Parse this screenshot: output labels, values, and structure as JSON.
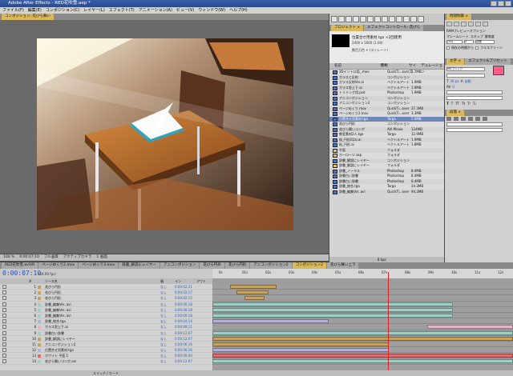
{
  "window": {
    "title": "Adobe After Effects - RED花吹雪.aep *"
  },
  "menu": [
    "ファイル(F)",
    "編集(E)",
    "コンポジション(C)",
    "レイヤー(L)",
    "エフェクト(T)",
    "アニメーション(A)",
    "ビュー(V)",
    "ウィンドウ(W)",
    "ヘルプ(H)"
  ],
  "comp_tabs": [
    "コンポジション: 花びら舞い"
  ],
  "viewer_footer": [
    "100 %",
    "0:00:07:10",
    "フル画質",
    "アクティブカメラ",
    "1 画面"
  ],
  "project_tabs": [
    "プロジェクト ×",
    "エフェクトコントロール: 花びら"
  ],
  "project": {
    "selected_name": "位置合せ用素材.tga ×2回使用",
    "selected_dims": "2400 x 1600 (1.00)",
    "selected_color": "数百万色 + (ストレート)",
    "columns": [
      "名前",
      "種類",
      "サイズ",
      "デュレーション"
    ],
    "items": [
      {
        "name": "3Dイントロ用_.mov",
        "type": "QuickTi...over",
        "size": "1.7MB",
        "folder": false
      },
      {
        "name": "ガラスと反射",
        "type": "コンポジション",
        "size": "",
        "folder": false
      },
      {
        "name": "ガラス反射Ver.ai",
        "type": "ベクトルアート",
        "size": "1.9MB",
        "folder": false
      },
      {
        "name": "ガラス窓上下.ai",
        "type": "ベクトルアート",
        "size": "1.9MB",
        "folder": false
      },
      {
        "name": "トリミング用.psd",
        "type": "Photoshop",
        "size": "1.9MB",
        "folder": false
      },
      {
        "name": "アニコンポジション",
        "type": "コンポジション",
        "size": "",
        "folder": false
      },
      {
        "name": "アニコンポジション2",
        "type": "コンポジション",
        "size": "",
        "folder": false
      },
      {
        "name": "ページめくり.mov",
        "type": "QuickTi...over",
        "size": "37.3MB",
        "folder": false
      },
      {
        "name": "ページめくり2.mov",
        "type": "QuickTi...over",
        "size": "3.3MB",
        "folder": false
      },
      {
        "name": "位置合せ用素材.tga",
        "type": "Targa",
        "size": "5.6MB",
        "folder": false
      },
      {
        "name": "花びら円形",
        "type": "コンポジション",
        "size": "",
        "folder": false
      },
      {
        "name": "花びら舞いコンポ",
        "type": "AVI Movie",
        "size": "124MB",
        "folder": false
      },
      {
        "name": "教室素材2人.tga",
        "type": "Targa",
        "size": "12.9MB",
        "folder": false
      },
      {
        "name": "桜_円形02ai.ai",
        "type": "ベクトルアート",
        "size": "1.9MB",
        "folder": false
      },
      {
        "name": "桜_円形.ai",
        "type": "ベクトルアート",
        "size": "1.8MB",
        "folder": false
      },
      {
        "name": "平面",
        "type": "フォルダ",
        "size": "",
        "folder": true
      },
      {
        "name": "ホーローツ.asp",
        "type": "フォルダ",
        "size": "",
        "folder": true
      },
      {
        "name": "辞書_解説にレイヤー",
        "type": "コンポジション",
        "size": "",
        "folder": false
      },
      {
        "name": "辞書_解説にレイヤー",
        "type": "フォルダ",
        "size": "",
        "folder": true
      },
      {
        "name": "辞書_ノーマル",
        "type": "Photoshop",
        "size": "8.4MB",
        "folder": false
      },
      {
        "name": "辞書白い辞書",
        "type": "Photoshop",
        "size": "8.4MB",
        "folder": false
      },
      {
        "name": "辞書白い辞書",
        "type": "Photoshop",
        "size": "8.4MB",
        "folder": false
      },
      {
        "name": "辞書_統合.tga",
        "type": "Targa",
        "size": "24.3MB",
        "folder": false
      },
      {
        "name": "辞書_編集Ver..avi",
        "type": "QuickTi...over",
        "size": "94.2MB",
        "folder": false
      }
    ],
    "footer": "8 bpc"
  },
  "right_panel": {
    "tools_title": "時間制御 ×",
    "ram_preview": "RAMプレビューオプション",
    "framerate_label": "フレームレート",
    "skip_label": "スキップ",
    "res_label": "解像度",
    "framerate_value": "(30)",
    "skip_value": "0",
    "res_value": "自動",
    "from_current": "現在の時間から",
    "full_screen": "フルスクリーン",
    "char_tabs": [
      "文字 ×",
      "エフェクト&プリセット"
    ],
    "font_name": "MSゴシック",
    "font_size": "36 px",
    "tracking": "0",
    "leading": "自動",
    "para_title": "段落 ×",
    "swatch_color": "#ff5c8a"
  },
  "timeline_tabs": [
    "RED花吹雪.aviVR",
    "ページめくり2.mov",
    "ページめくり3.mov",
    "辞書_解説にレイヤー",
    "アニコンポジション",
    "花びら円形",
    "花びら円形",
    "アニコンポジション2",
    "コンポジション2",
    "花びら舞い上下"
  ],
  "timeline": {
    "timecode": "0:00:07:10",
    "fps": "(24.00 fps)",
    "col_labels": [
      "#",
      "ソース名",
      "親",
      "イン",
      "アウト"
    ],
    "ruler": [
      "0s",
      "01s",
      "02s",
      "03s",
      "04s",
      "05s",
      "06s",
      "07s",
      "08s",
      "09s",
      "10s",
      "11s",
      "12s"
    ],
    "layers": [
      {
        "num": "1",
        "name": "花びら円形",
        "parent": "なし",
        "in": "0:00:02:21",
        "color": "#c9a25a"
      },
      {
        "num": "2",
        "name": "花びら円形",
        "parent": "なし",
        "in": "0:00:02:17",
        "color": "#c9a25a"
      },
      {
        "num": "3",
        "name": "花びら円形",
        "parent": "なし",
        "in": "0:00:02:15",
        "color": "#c9a25a"
      },
      {
        "num": "4",
        "name": "辞書_編集Ver..avi",
        "parent": "なし",
        "in": "0:00:00:18",
        "color": "#9fd0c8"
      },
      {
        "num": "5",
        "name": "辞書_編集Ver..avi",
        "parent": "なし",
        "in": "0:00:00:18",
        "color": "#9fd0c8"
      },
      {
        "num": "6",
        "name": "辞書_編集Ver..avi",
        "parent": "なし",
        "in": "0:00:00:18",
        "color": "#9fd0c8"
      },
      {
        "num": "7",
        "name": "辞書_統合.tga",
        "parent": "なし",
        "in": "0:00:04:14",
        "color": "#b4b0de"
      },
      {
        "num": "8",
        "name": "ガラス窓上下.ai",
        "parent": "なし",
        "in": "0:00:09:11",
        "color": "#e3b6c6"
      },
      {
        "num": "9",
        "name": "辞書白い辞書",
        "parent": "なし",
        "in": "0:00:12:07",
        "color": "#9fd0c8"
      },
      {
        "num": "10",
        "name": "辞書_解説にレイヤー",
        "parent": "なし",
        "in": "0:00:12:07",
        "color": "#c9a25a"
      },
      {
        "num": "11",
        "name": "アニコンポジション2",
        "parent": "なし",
        "in": "0:00:06:16",
        "color": "#c9a25a"
      },
      {
        "num": "12",
        "name": "位置合せ用素材.tga",
        "parent": "なし",
        "in": "0:00:06:16",
        "color": "#b4b0de"
      },
      {
        "num": "13",
        "name": "ホワイト 平面 1",
        "parent": "なし",
        "in": "0:00:00:00",
        "color": "#e46a6a"
      },
      {
        "num": "14",
        "name": "花びら舞いコンポ.avi",
        "parent": "なし",
        "in": "0:00:12:07",
        "color": "#9fd0c8"
      }
    ],
    "status": "スイッチ / モード"
  }
}
